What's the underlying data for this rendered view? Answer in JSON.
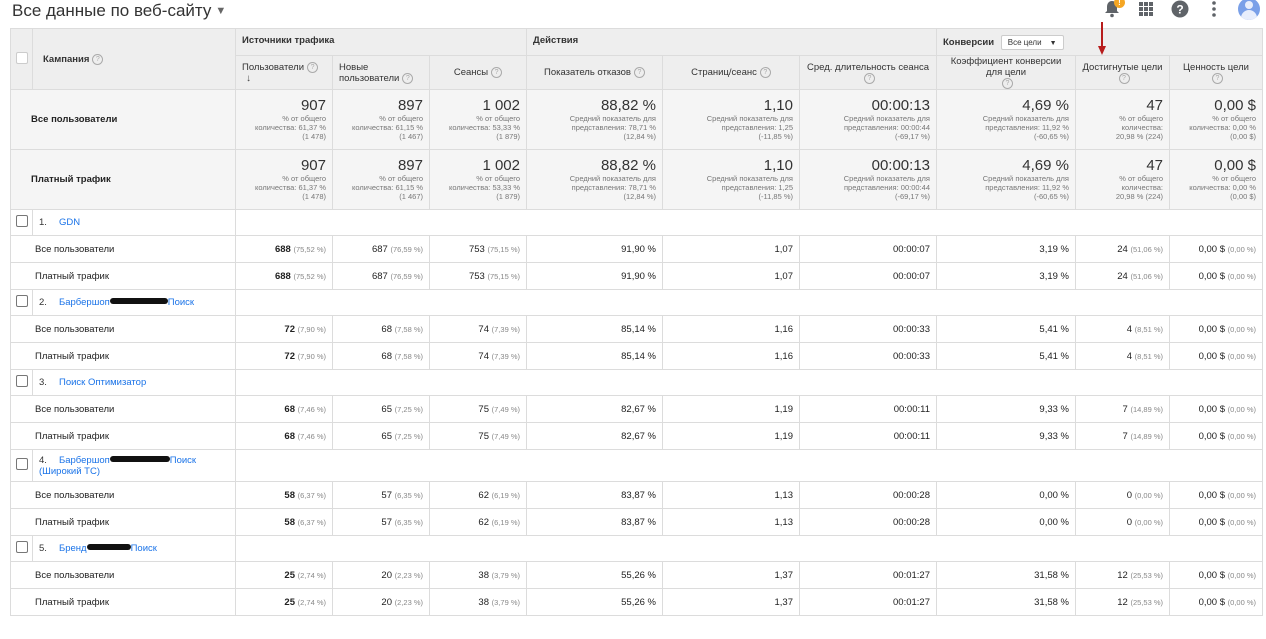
{
  "title": "Все данные по веб-сайту",
  "header": {
    "campaign": "Кампания",
    "group_traffic": "Источники трафика",
    "group_actions": "Действия",
    "group_conversions": "Конверсии",
    "goal_select": "Все цели",
    "cols": [
      "Пользователи",
      "Новые пользователи",
      "Сеансы",
      "Показатель отказов",
      "Страниц/сеанс",
      "Сред. длительность сеанса",
      "Коэффициент конверсии для цели",
      "Достигнутые цели",
      "Ценность цели"
    ]
  },
  "totals": [
    {
      "label": "Все пользователи",
      "cells": [
        {
          "big": "907",
          "s1": "% от общего",
          "s2": "количества: 61,37 %",
          "s3": "(1 478)"
        },
        {
          "big": "897",
          "s1": "% от общего",
          "s2": "количества: 61,15 %",
          "s3": "(1 467)"
        },
        {
          "big": "1 002",
          "s1": "% от общего",
          "s2": "количества: 53,33 %",
          "s3": "(1 879)"
        },
        {
          "big": "88,82 %",
          "s1": "Средний показатель для",
          "s2": "представления: 78,71 %",
          "s3": "(12,84 %)"
        },
        {
          "big": "1,10",
          "s1": "Средний показатель для",
          "s2": "представления: 1,25",
          "s3": "(-11,85 %)"
        },
        {
          "big": "00:00:13",
          "s1": "Средний показатель для",
          "s2": "представления: 00:00:44",
          "s3": "(-69,17 %)"
        },
        {
          "big": "4,69 %",
          "s1": "Средний показатель для",
          "s2": "представления: 11,92 %",
          "s3": "(-60,65 %)"
        },
        {
          "big": "47",
          "s1": "% от общего",
          "s2": "количества:",
          "s3": "20,98 % (224)"
        },
        {
          "big": "0,00 $",
          "s1": "% от общего",
          "s2": "количества: 0,00 %",
          "s3": "(0,00 $)"
        }
      ]
    },
    {
      "label": "Платный трафик",
      "cells": [
        {
          "big": "907",
          "s1": "% от общего",
          "s2": "количества: 61,37 %",
          "s3": "(1 478)"
        },
        {
          "big": "897",
          "s1": "% от общего",
          "s2": "количества: 61,15 %",
          "s3": "(1 467)"
        },
        {
          "big": "1 002",
          "s1": "% от общего",
          "s2": "количества: 53,33 %",
          "s3": "(1 879)"
        },
        {
          "big": "88,82 %",
          "s1": "Средний показатель для",
          "s2": "представления: 78,71 %",
          "s3": "(12,84 %)"
        },
        {
          "big": "1,10",
          "s1": "Средний показатель для",
          "s2": "представления: 1,25",
          "s3": "(-11,85 %)"
        },
        {
          "big": "00:00:13",
          "s1": "Средний показатель для",
          "s2": "представления: 00:00:44",
          "s3": "(-69,17 %)"
        },
        {
          "big": "4,69 %",
          "s1": "Средний показатель для",
          "s2": "представления: 11,92 %",
          "s3": "(-60,65 %)"
        },
        {
          "big": "47",
          "s1": "% от общего",
          "s2": "количества:",
          "s3": "20,98 % (224)"
        },
        {
          "big": "0,00 $",
          "s1": "% от общего",
          "s2": "количества: 0,00 %",
          "s3": "(0,00 $)"
        }
      ]
    }
  ],
  "seg_labels": [
    "Все пользователи",
    "Платный трафик"
  ],
  "campaigns": [
    {
      "idx": "1.",
      "name1": "GDN",
      "name2": "",
      "row": [
        [
          "688",
          "(75,52 %)"
        ],
        [
          "687",
          "(76,59 %)"
        ],
        [
          "753",
          "(75,15 %)"
        ],
        [
          "91,90 %",
          ""
        ],
        [
          "1,07",
          ""
        ],
        [
          "00:00:07",
          ""
        ],
        [
          "3,19 %",
          ""
        ],
        [
          "24",
          "(51,06 %)"
        ],
        [
          "0,00 $",
          "(0,00 %)"
        ]
      ]
    },
    {
      "idx": "2.",
      "name1": "Барбершоп",
      "name2": "Поиск",
      "row": [
        [
          "72",
          "(7,90 %)"
        ],
        [
          "68",
          "(7,58 %)"
        ],
        [
          "74",
          "(7,39 %)"
        ],
        [
          "85,14 %",
          ""
        ],
        [
          "1,16",
          ""
        ],
        [
          "00:00:33",
          ""
        ],
        [
          "5,41 %",
          ""
        ],
        [
          "4",
          "(8,51 %)"
        ],
        [
          "0,00 $",
          "(0,00 %)"
        ]
      ]
    },
    {
      "idx": "3.",
      "name1": "Поиск Оптимизатор",
      "name2": "",
      "row": [
        [
          "68",
          "(7,46 %)"
        ],
        [
          "65",
          "(7,25 %)"
        ],
        [
          "75",
          "(7,49 %)"
        ],
        [
          "82,67 %",
          ""
        ],
        [
          "1,19",
          ""
        ],
        [
          "00:00:11",
          ""
        ],
        [
          "9,33 %",
          ""
        ],
        [
          "7",
          "(14,89 %)"
        ],
        [
          "0,00 $",
          "(0,00 %)"
        ]
      ]
    },
    {
      "idx": "4.",
      "name1": "Барбершоп",
      "name2": "Поиск",
      "name3": "(Широкий ТС)",
      "row": [
        [
          "58",
          "(6,37 %)"
        ],
        [
          "57",
          "(6,35 %)"
        ],
        [
          "62",
          "(6,19 %)"
        ],
        [
          "83,87 %",
          ""
        ],
        [
          "1,13",
          ""
        ],
        [
          "00:00:28",
          ""
        ],
        [
          "0,00 %",
          ""
        ],
        [
          "0",
          "(0,00 %)"
        ],
        [
          "0,00 $",
          "(0,00 %)"
        ]
      ]
    },
    {
      "idx": "5.",
      "name1": "Бренд",
      "name2": "Поиск",
      "row": [
        [
          "25",
          "(2,74 %)"
        ],
        [
          "20",
          "(2,23 %)"
        ],
        [
          "38",
          "(3,79 %)"
        ],
        [
          "55,26 %",
          ""
        ],
        [
          "1,37",
          ""
        ],
        [
          "00:01:27",
          ""
        ],
        [
          "31,58 %",
          ""
        ],
        [
          "12",
          "(25,53 %)"
        ],
        [
          "0,00 $",
          "(0,00 %)"
        ]
      ]
    }
  ]
}
